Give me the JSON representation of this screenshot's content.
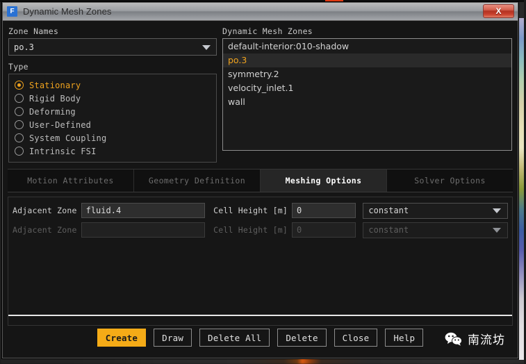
{
  "window": {
    "title": "Dynamic Mesh Zones",
    "app_icon": "fluent-f-icon",
    "close_label": "X"
  },
  "zone_names": {
    "label": "Zone Names",
    "selected": "po.3",
    "options": [
      "default-interior:010-shadow",
      "po.3",
      "symmetry.2",
      "velocity_inlet.1",
      "wall"
    ]
  },
  "type": {
    "label": "Type",
    "selected": "Stationary",
    "options": [
      {
        "label": "Stationary",
        "checked": true
      },
      {
        "label": "Rigid Body",
        "checked": false
      },
      {
        "label": "Deforming",
        "checked": false
      },
      {
        "label": "User-Defined",
        "checked": false
      },
      {
        "label": "System Coupling",
        "checked": false
      },
      {
        "label": "Intrinsic FSI",
        "checked": false
      }
    ]
  },
  "dynamic_mesh_zones": {
    "label": "Dynamic Mesh Zones",
    "items": [
      {
        "label": "default-interior:010-shadow",
        "selected": false
      },
      {
        "label": "po.3",
        "selected": true
      },
      {
        "label": "symmetry.2",
        "selected": false
      },
      {
        "label": "velocity_inlet.1",
        "selected": false
      },
      {
        "label": "wall",
        "selected": false
      }
    ]
  },
  "tabs": [
    {
      "label": "Motion Attributes",
      "active": false
    },
    {
      "label": "Geometry Definition",
      "active": false
    },
    {
      "label": "Meshing Options",
      "active": true
    },
    {
      "label": "Solver Options",
      "active": false
    }
  ],
  "meshing_options": {
    "rows": [
      {
        "zone_label": "Adjacent Zone",
        "zone_value": "fluid.4",
        "cell_height_label": "Cell Height [m]",
        "cell_height_value": "0",
        "profile": "constant",
        "enabled": true
      },
      {
        "zone_label": "Adjacent Zone",
        "zone_value": "",
        "cell_height_label": "Cell Height [m]",
        "cell_height_value": "0",
        "profile": "constant",
        "enabled": false
      }
    ]
  },
  "footer": {
    "buttons": [
      {
        "label": "Create",
        "primary": true
      },
      {
        "label": "Draw",
        "primary": false
      },
      {
        "label": "Delete All",
        "primary": false
      },
      {
        "label": "Delete",
        "primary": false
      },
      {
        "label": "Close",
        "primary": false
      },
      {
        "label": "Help",
        "primary": false
      }
    ],
    "watermark_text": "南流坊",
    "watermark_icon": "wechat-icon"
  },
  "colors": {
    "accent": "#f0a31e",
    "primary_button": "#f5ab17",
    "close_button": "#c8402c",
    "app_icon": "#2a72d4"
  }
}
